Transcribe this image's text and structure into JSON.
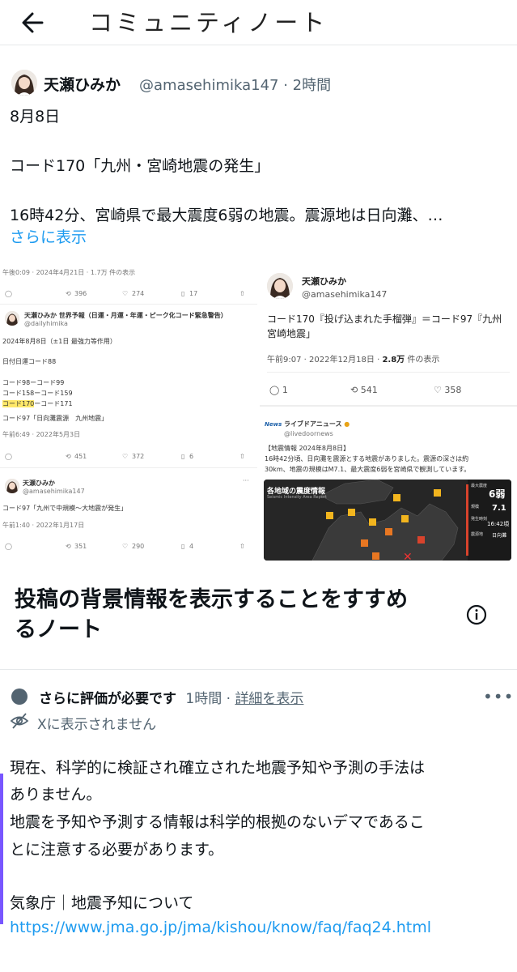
{
  "header": {
    "title": "コミュニティノート"
  },
  "post": {
    "author_name": "天瀬ひみか",
    "author_handle": "@amasehimika147 · 2時間",
    "line1": "8月8日",
    "line2": "コード170「九州・宮崎地震の発生」",
    "line3": "16時42分、宮崎県で最大震度6弱の地震。震源地は日向灘、…",
    "show_more": "さらに表示"
  },
  "images": {
    "left_top": {
      "timestamp": "午後0:09 · 2024年4月21日 · 1.7万 件の表示",
      "retweets": "396",
      "likes": "274",
      "bookmarks": "17"
    },
    "left_main": {
      "name": "天瀬ひみか 世界予報（日運・月運・年運・ピーク化コード緊急警告）",
      "handle": "@dailyhimika",
      "l1": "2024年8月8日（±1日 最強力等作用）",
      "l2": "日付日運コード88",
      "l3": "コード98ーコード99",
      "l4": "コード158ーコード159",
      "l5a": "コード170",
      "l5b": "ーコード171",
      "l6": "コード97「日向灘震源　九州地震」",
      "time": "午前6:49 · 2022年5月3日",
      "retweets": "451",
      "likes": "372",
      "bookmarks": "6"
    },
    "left_bottom": {
      "name": "天瀬ひみか",
      "handle": "@amasehimika147",
      "text": "コード97「九州で中規模〜大地震が発生」",
      "time": "午前1:40 · 2022年1月17日",
      "retweets": "351",
      "likes": "290",
      "bookmarks": "4"
    },
    "right_top": {
      "name": "天瀬ひみか",
      "handle": "@amasehimika147",
      "text1": "コード170『投げ込まれた手榴弾』＝コード97『九州",
      "text2": "宮崎地震」",
      "time": "午前9:07 · 2022年12月18日 · ",
      "views_count": "2.8万",
      "views_suffix": " 件の表示",
      "replies": "1",
      "retweets": "541",
      "likes": "358"
    },
    "right_news": {
      "logo": "News",
      "name": "ライブドアニュース",
      "handle": "@livedoornews",
      "l1": "【地震情報 2024年8月8日】",
      "l2": "16時42分頃、日向灘を震源とする地震がありました。震源の深さは約",
      "l3": "30km、地震の規模はM7.1、最大震度6弱を宮崎県で観測しています。",
      "map_title": "各地域の震度情報",
      "map_sub": "Seismic Intensity Area Report",
      "max_label": "最大震度",
      "max_value": "6弱",
      "mag_label": "規模",
      "mag_value": "7.1",
      "time_label": "発生時刻",
      "time_value": "16:42頃",
      "region_label": "震源地",
      "region_value": "日向灘"
    }
  },
  "note": {
    "heading": "投稿の背景情報を表示することをすすめるノート",
    "heading_l1": "投稿の背景情報を表示することをすすめ",
    "heading_l2": "るノート",
    "status": "さらに評価が必要です",
    "time": "1時間 · ",
    "details_link": "詳細を表示",
    "not_shown": "Xに表示されません",
    "body1": "現在、科学的に検証され確立された地震予知や予測の手法は",
    "body2": "ありません。",
    "body3": "地震を予知や予測する情報は科学的根拠のないデマであるこ",
    "body4": "とに注意する必要があります。",
    "source": "気象庁｜地震予知について",
    "url": "https://www.jma.go.jp/jma/kishou/know/faq/faq24.html"
  },
  "colors": {
    "link": "#1d9bf0",
    "text": "#0f1419",
    "muted": "#536471",
    "note_bar": "#7856ff"
  }
}
